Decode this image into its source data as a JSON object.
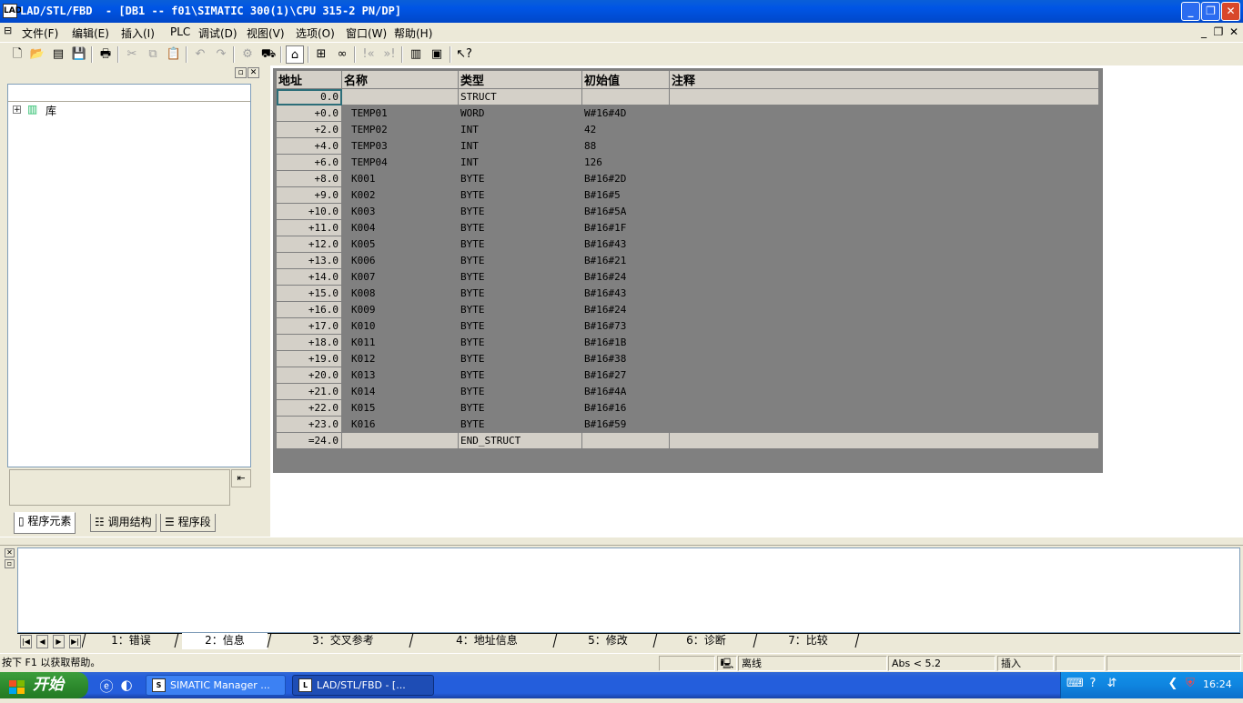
{
  "window": {
    "title": "LAD/STL/FBD  - [DB1 -- f01\\SIMATIC 300(1)\\CPU 315-2 PN/DP]",
    "app_icon_text": "LAD"
  },
  "menu": {
    "items": [
      "文件(F)",
      "编辑(E)",
      "插入(I)",
      "PLC",
      "调试(D)",
      "视图(V)",
      "选项(O)",
      "窗口(W)",
      "帮助(H)"
    ]
  },
  "left_panel": {
    "tree_root_label": "库",
    "tabs": [
      "程序元素",
      "调用结构",
      "程序段"
    ]
  },
  "table": {
    "headers": [
      "地址",
      "名称",
      "类型",
      "初始值",
      "注释"
    ],
    "rows": [
      {
        "addr": "0.0",
        "name": "",
        "type": "STRUCT",
        "init": "",
        "comment": ""
      },
      {
        "addr": "+0.0",
        "name": "TEMP01",
        "type": "WORD",
        "init": "W#16#4D",
        "comment": ""
      },
      {
        "addr": "+2.0",
        "name": "TEMP02",
        "type": "INT",
        "init": "42",
        "comment": ""
      },
      {
        "addr": "+4.0",
        "name": "TEMP03",
        "type": "INT",
        "init": "88",
        "comment": ""
      },
      {
        "addr": "+6.0",
        "name": "TEMP04",
        "type": "INT",
        "init": "126",
        "comment": ""
      },
      {
        "addr": "+8.0",
        "name": "K001",
        "type": "BYTE",
        "init": "B#16#2D",
        "comment": ""
      },
      {
        "addr": "+9.0",
        "name": "K002",
        "type": "BYTE",
        "init": "B#16#5",
        "comment": ""
      },
      {
        "addr": "+10.0",
        "name": "K003",
        "type": "BYTE",
        "init": "B#16#5A",
        "comment": ""
      },
      {
        "addr": "+11.0",
        "name": "K004",
        "type": "BYTE",
        "init": "B#16#1F",
        "comment": ""
      },
      {
        "addr": "+12.0",
        "name": "K005",
        "type": "BYTE",
        "init": "B#16#43",
        "comment": ""
      },
      {
        "addr": "+13.0",
        "name": "K006",
        "type": "BYTE",
        "init": "B#16#21",
        "comment": ""
      },
      {
        "addr": "+14.0",
        "name": "K007",
        "type": "BYTE",
        "init": "B#16#24",
        "comment": ""
      },
      {
        "addr": "+15.0",
        "name": "K008",
        "type": "BYTE",
        "init": "B#16#43",
        "comment": ""
      },
      {
        "addr": "+16.0",
        "name": "K009",
        "type": "BYTE",
        "init": "B#16#24",
        "comment": ""
      },
      {
        "addr": "+17.0",
        "name": "K010",
        "type": "BYTE",
        "init": "B#16#73",
        "comment": ""
      },
      {
        "addr": "+18.0",
        "name": "K011",
        "type": "BYTE",
        "init": "B#16#1B",
        "comment": ""
      },
      {
        "addr": "+19.0",
        "name": "K012",
        "type": "BYTE",
        "init": "B#16#38",
        "comment": ""
      },
      {
        "addr": "+20.0",
        "name": "K013",
        "type": "BYTE",
        "init": "B#16#27",
        "comment": ""
      },
      {
        "addr": "+21.0",
        "name": "K014",
        "type": "BYTE",
        "init": "B#16#4A",
        "comment": ""
      },
      {
        "addr": "+22.0",
        "name": "K015",
        "type": "BYTE",
        "init": "B#16#16",
        "comment": ""
      },
      {
        "addr": "+23.0",
        "name": "K016",
        "type": "BYTE",
        "init": "B#16#59",
        "comment": ""
      },
      {
        "addr": "=24.0",
        "name": "",
        "type": "END_STRUCT",
        "init": "",
        "comment": ""
      }
    ]
  },
  "output_panel": {
    "tabs": [
      "1：错误",
      "2：信息",
      "3：交叉参考",
      "4：地址信息",
      "5：修改",
      "6：诊断",
      "7：比较"
    ],
    "active_tab": "2：信息"
  },
  "status_bar": {
    "help_text": "按下 F1 以获取帮助。",
    "mode": "离线",
    "abs": "Abs < 5.2",
    "insert": "插入"
  },
  "taskbar": {
    "start_label": "开始",
    "tasks": [
      "SIMATIC Manager ...",
      "LAD/STL/FBD  - [..."
    ],
    "clock": "16:24"
  },
  "colors": {
    "titlebar": "#0055E5",
    "taskbar": "#245EDC",
    "start_button": "#2E8B2E",
    "table_header": "#D4D0C8",
    "selection_outline": "#2C6E79"
  }
}
